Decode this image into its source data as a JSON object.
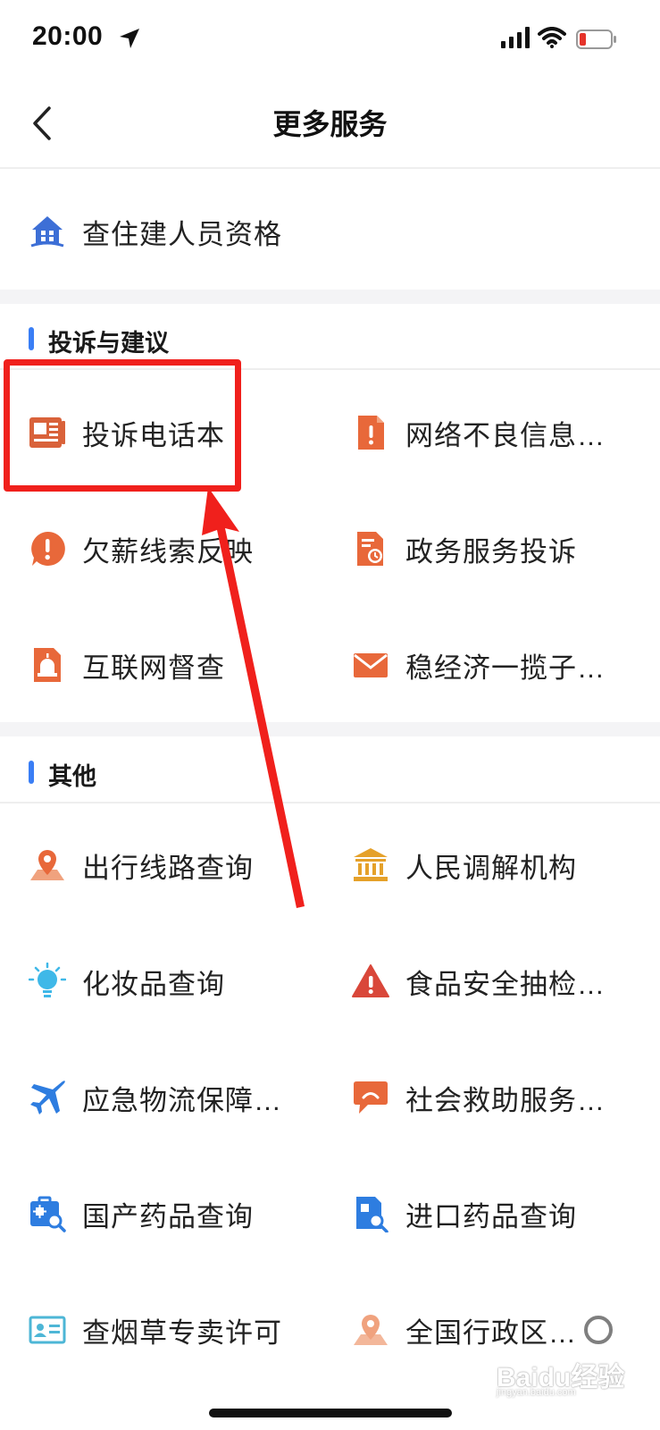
{
  "status": {
    "time": "20:00"
  },
  "nav": {
    "title": "更多服务"
  },
  "top_item": {
    "label": "查住建人员资格",
    "icon": "house-icon"
  },
  "sections": [
    {
      "title": "投诉与建议",
      "items": [
        {
          "label": "投诉电话本",
          "icon": "phonebook-icon"
        },
        {
          "label": "网络不良信息…",
          "icon": "report-doc-icon"
        },
        {
          "label": "欠薪线索反映",
          "icon": "alert-circle-icon"
        },
        {
          "label": "政务服务投诉",
          "icon": "doc-clock-icon"
        },
        {
          "label": "互联网督查",
          "icon": "doc-siren-icon"
        },
        {
          "label": "稳经济一揽子…",
          "icon": "mail-icon"
        }
      ]
    },
    {
      "title": "其他",
      "items": [
        {
          "label": "出行线路查询",
          "icon": "map-pin-icon"
        },
        {
          "label": "人民调解机构",
          "icon": "bank-icon"
        },
        {
          "label": "化妆品查询",
          "icon": "bulb-icon"
        },
        {
          "label": "食品安全抽检…",
          "icon": "warning-icon"
        },
        {
          "label": "应急物流保障…",
          "icon": "plane-icon"
        },
        {
          "label": "社会救助服务…",
          "icon": "chat-bubble-icon"
        },
        {
          "label": "国产药品查询",
          "icon": "medkit-search-icon"
        },
        {
          "label": "进口药品查询",
          "icon": "doc-search-icon"
        },
        {
          "label": "查烟草专卖许可",
          "icon": "id-card-icon"
        },
        {
          "label": "全国行政区…",
          "icon": "map-location-icon"
        }
      ]
    }
  ],
  "colors": {
    "accent": "#3a7ef5",
    "orange": "#e8683a",
    "annotation": "#f0201c"
  },
  "watermark": {
    "text": "Baidu经验",
    "sub": "jingyan.baidu.com"
  }
}
